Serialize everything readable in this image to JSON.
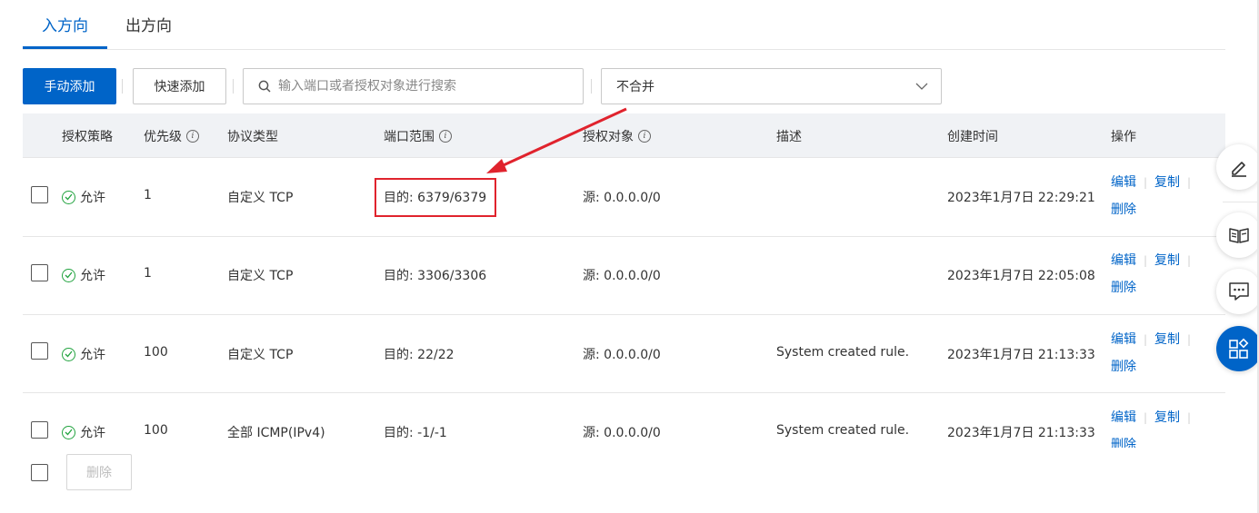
{
  "tabs": [
    {
      "label": "入方向",
      "active": true
    },
    {
      "label": "出方向",
      "active": false
    }
  ],
  "toolbar": {
    "manual_add": "手动添加",
    "quick_add": "快速添加",
    "search_placeholder": "输入端口或者授权对象进行搜索",
    "merge_select": "不合并"
  },
  "table": {
    "headers": {
      "policy": "授权策略",
      "priority": "优先级",
      "protocol": "协议类型",
      "port": "端口范围",
      "auth_object": "授权对象",
      "description": "描述",
      "created": "创建时间",
      "actions": "操作"
    },
    "rows": [
      {
        "policy": "允许",
        "priority": "1",
        "protocol": "自定义 TCP",
        "port": "目的: 6379/6379",
        "auth_object": "源: 0.0.0.0/0",
        "description": "",
        "created": "2023年1月7日 22:29:21",
        "highlighted": true
      },
      {
        "policy": "允许",
        "priority": "1",
        "protocol": "自定义 TCP",
        "port": "目的: 3306/3306",
        "auth_object": "源: 0.0.0.0/0",
        "description": "",
        "created": "2023年1月7日 22:05:08"
      },
      {
        "policy": "允许",
        "priority": "100",
        "protocol": "自定义 TCP",
        "port": "目的: 22/22",
        "auth_object": "源: 0.0.0.0/0",
        "description": "System created rule.",
        "created": "2023年1月7日 21:13:33"
      },
      {
        "policy": "允许",
        "priority": "100",
        "protocol": "全部 ICMP(IPv4)",
        "port": "目的: -1/-1",
        "auth_object": "源: 0.0.0.0/0",
        "description": "System created rule.",
        "created": "2023年1月7日 21:13:33"
      }
    ],
    "actions": {
      "edit": "编辑",
      "copy": "复制",
      "delete": "删除"
    }
  },
  "footer": {
    "batch_delete": "删除"
  },
  "colors": {
    "primary": "#0064c8",
    "annotation": "#e0232d",
    "allow_green": "#22a33f"
  },
  "icons": [
    "search-icon",
    "chevron-down-icon",
    "info-icon",
    "check-circle-icon",
    "edit-pen-icon",
    "book-icon",
    "chat-icon",
    "apps-icon",
    "annotation-arrow"
  ]
}
